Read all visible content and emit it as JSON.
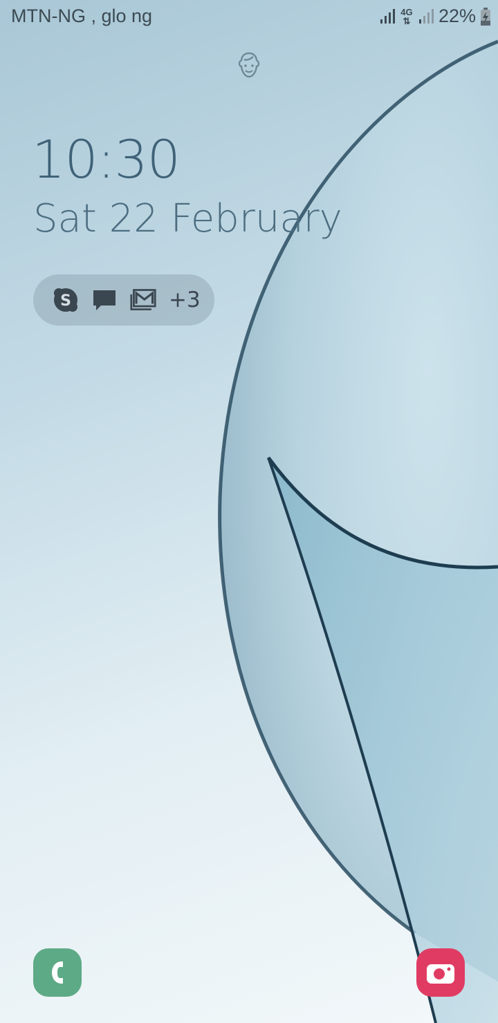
{
  "status_bar": {
    "carrier": "MTN-NG , glo ng",
    "network_type": "4G",
    "battery_percent": "22%",
    "charging": true
  },
  "lockscreen": {
    "time": "10:30",
    "date": "Sat 22 February"
  },
  "notifications": {
    "icons": [
      "skype-icon",
      "message-icon",
      "gmail-icon"
    ],
    "more_count": "+3"
  },
  "shortcuts": {
    "left": {
      "icon": "phone-icon",
      "color": "#5daa86"
    },
    "right": {
      "icon": "camera-icon",
      "color": "#e03c63"
    }
  },
  "colors": {
    "clock": "#3f6278",
    "date": "#4c6d80"
  }
}
